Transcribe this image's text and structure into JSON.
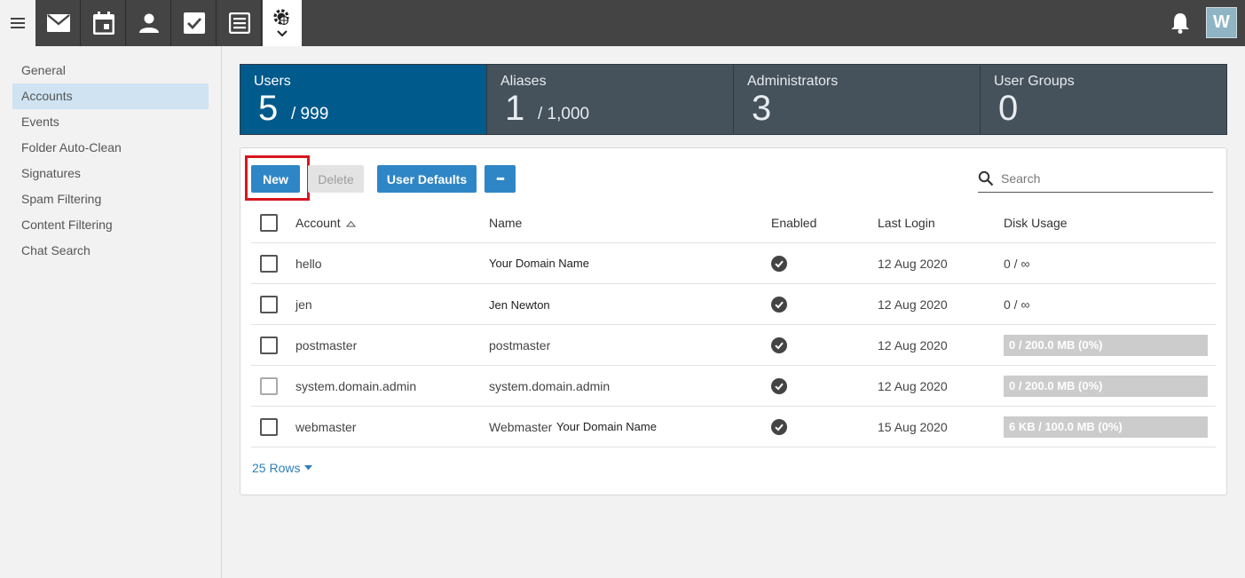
{
  "topbar": {
    "apps": [
      {
        "icon": "mail-icon"
      },
      {
        "icon": "calendar-icon"
      },
      {
        "icon": "contacts-icon"
      },
      {
        "icon": "tasks-icon"
      },
      {
        "icon": "notes-icon"
      },
      {
        "icon": "settings-icon"
      }
    ],
    "avatar_letter": "W"
  },
  "sidebar": {
    "items": [
      {
        "label": "General"
      },
      {
        "label": "Accounts",
        "active": true
      },
      {
        "label": "Events"
      },
      {
        "label": "Folder Auto-Clean"
      },
      {
        "label": "Signatures"
      },
      {
        "label": "Spam Filtering"
      },
      {
        "label": "Content Filtering"
      },
      {
        "label": "Chat Search"
      }
    ]
  },
  "stats": [
    {
      "label": "Users",
      "value": "5",
      "max": "/ 999",
      "active": true
    },
    {
      "label": "Aliases",
      "value": "1",
      "max": "/ 1,000"
    },
    {
      "label": "Administrators",
      "value": "3",
      "max": ""
    },
    {
      "label": "User Groups",
      "value": "0",
      "max": ""
    }
  ],
  "toolbar": {
    "new_label": "New",
    "delete_label": "Delete",
    "user_defaults_label": "User Defaults",
    "more_label": "•••",
    "search_placeholder": "Search"
  },
  "table": {
    "headers": {
      "account": "Account",
      "name": "Name",
      "enabled": "Enabled",
      "last_login": "Last Login",
      "disk_usage": "Disk Usage"
    },
    "rows": [
      {
        "account": "hello",
        "name": "",
        "name_extra": "Your Domain Name",
        "last_login": "12 Aug 2020",
        "disk": "0 / ∞",
        "disk_bar": false
      },
      {
        "account": "jen",
        "name": "",
        "name_extra": "Jen Newton",
        "last_login": "12 Aug 2020",
        "disk": "0 / ∞",
        "disk_bar": false
      },
      {
        "account": "postmaster",
        "name": "postmaster",
        "name_extra": "",
        "last_login": "12 Aug 2020",
        "disk": "0 / 200.0 MB (0%)",
        "disk_bar": true
      },
      {
        "account": "system.domain.admin",
        "name": "system.domain.admin",
        "name_extra": "",
        "last_login": "12 Aug 2020",
        "disk": "0 / 200.0 MB (0%)",
        "disk_bar": true
      },
      {
        "account": "webmaster",
        "name": "Webmaster",
        "name_extra": "Your Domain Name",
        "last_login": "15 Aug 2020",
        "disk": "6 KB / 100.0 MB (0%)",
        "disk_bar": true
      }
    ]
  },
  "pagination": {
    "rows_label": "25 Rows"
  },
  "colors": {
    "accent": "#2f86c6",
    "active_card": "#005a8c",
    "highlight": "#d7161f"
  }
}
